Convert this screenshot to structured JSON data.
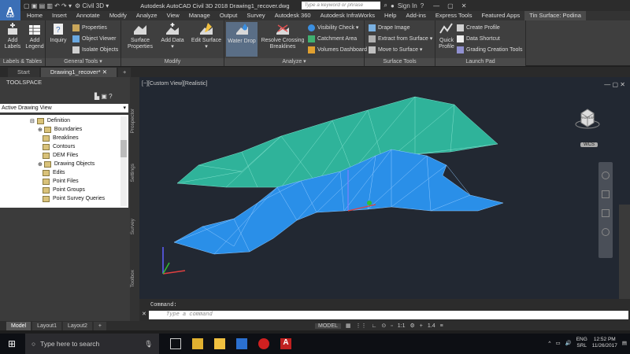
{
  "titlebar": {
    "app_letter": "A",
    "app_sub": "C3D",
    "workspace": "Civil 3D",
    "title": "Autodesk AutoCAD Civil 3D 2018    Drawing1_recover.dwg",
    "search_placeholder": "Type a keyword or phrase",
    "signin": "Sign In"
  },
  "ribbon_tabs": [
    "Home",
    "Insert",
    "Annotate",
    "Modify",
    "Analyze",
    "View",
    "Manage",
    "Output",
    "Survey",
    "Autodesk 360",
    "Autodesk InfraWorks",
    "Help",
    "Add-ins",
    "Express Tools",
    "Featured Apps",
    "Tin Surface: Podina"
  ],
  "ribbon": {
    "labels_tables": {
      "title": "Labels & Tables",
      "add_labels": "Add Labels",
      "add_legend": "Add Legend"
    },
    "general_tools": {
      "title": "General Tools",
      "inquiry": "Inquiry",
      "properties": "Properties",
      "object_viewer": "Object Viewer",
      "isolate": "Isolate Objects"
    },
    "modify": {
      "title": "Modify",
      "surface_properties": "Surface Properties",
      "add_data": "Add Data",
      "edit_surface": "Edit Surface"
    },
    "analyze": {
      "title": "Analyze",
      "water_drop": "Water Drop",
      "resolve_crossing": "Resolve Crossing Breaklines",
      "visibility_check": "Visibility Check",
      "catchment_area": "Catchment Area",
      "volumes_dashboard": "Volumes Dashboard"
    },
    "surface_tools": {
      "title": "Surface Tools",
      "drape_image": "Drape Image",
      "extract": "Extract from Surface",
      "move_to_surface": "Move to Surface"
    },
    "launch_pad": {
      "title": "Launch Pad",
      "quick_profile": "Quick Profile",
      "create_profile": "Create Profile",
      "data_shortcut": "Data Shortcut",
      "grading_creation": "Grading Creation Tools"
    }
  },
  "doc_tabs": [
    "Start",
    "Drawing1_recover*"
  ],
  "toolspace": {
    "title": "TOOLSPACE",
    "view_select": "Active Drawing View",
    "tree": [
      "Definition",
      "Boundaries",
      "Breaklines",
      "Contours",
      "DEM Files",
      "Drawing Objects",
      "Edits",
      "Point Files",
      "Point Groups",
      "Point Survey Queries"
    ],
    "side_tabs": [
      "Prospector",
      "Settings",
      "Survey",
      "Toolbox"
    ]
  },
  "viewport": {
    "label": "[−][Custom View][Realistic]",
    "viewcube_front": "FRONT",
    "viewcube_left": "LEFT",
    "ucs": "WCS"
  },
  "command": {
    "history": "Command:",
    "placeholder": "Type a command"
  },
  "layout_tabs": [
    "Model",
    "Layout1",
    "Layout2"
  ],
  "status": {
    "model": "MODEL",
    "scale": "1:1",
    "lineweight": "1.4"
  },
  "taskbar": {
    "search": "Type here to search",
    "lang": "ENG",
    "region": "SRL",
    "time": "12:52 PM",
    "date": "11/26/2017"
  },
  "colors": {
    "surface_green": "#2fb39a",
    "surface_blue": "#2a8fe8",
    "viewport_bg": "#222832",
    "accent": "#3b6fb6"
  }
}
